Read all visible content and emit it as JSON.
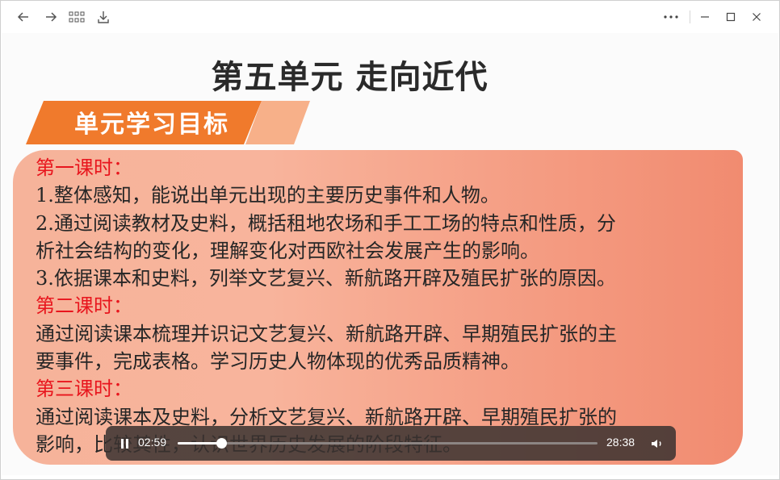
{
  "slide": {
    "title": "第五单元 走向近代",
    "banner": "单元学习目标",
    "lines": [
      {
        "text": "第一课时：",
        "red": true
      },
      {
        "text": "1.整体感知，能说出单元出现的主要历史事件和人物。",
        "red": false
      },
      {
        "text": "2.通过阅读教材及史料，概括租地农场和手工工场的特点和性质，分",
        "red": false
      },
      {
        "text": "析社会结构的变化，理解变化对西欧社会发展产生的影响。",
        "red": false
      },
      {
        "text": "3.依据课本和史料，列举文艺复兴、新航路开辟及殖民扩张的原因。",
        "red": false
      },
      {
        "text": "第二课时：",
        "red": true
      },
      {
        "text": "通过阅读课本梳理并识记文艺复兴、新航路开辟、早期殖民扩张的主",
        "red": false
      },
      {
        "text": "要事件，完成表格。学习历史人物体现的优秀品质精神。",
        "red": false
      },
      {
        "text": "第三课时：",
        "red": true
      },
      {
        "text": "通过阅读课本及史料，分析文艺复兴、新航路开辟、早期殖民扩张的",
        "red": false
      },
      {
        "text": "影响，比较其性，认识世界历史发展的阶段特征。",
        "red": false
      }
    ]
  },
  "player": {
    "current_time": "02:59",
    "duration": "28:38",
    "progress": 0.104
  },
  "icons": {
    "back": "arrow-left-icon",
    "forward": "arrow-right-icon",
    "grid": "grid-view-icon",
    "download": "download-icon",
    "more": "more-options-icon",
    "minimize": "minimize-icon",
    "maximize": "maximize-icon",
    "close": "close-icon",
    "pause": "pause-icon",
    "volume": "volume-icon"
  },
  "colors": {
    "banner": "#f07a2c",
    "panel": "#f6a88e",
    "highlight": "#e8151d"
  }
}
